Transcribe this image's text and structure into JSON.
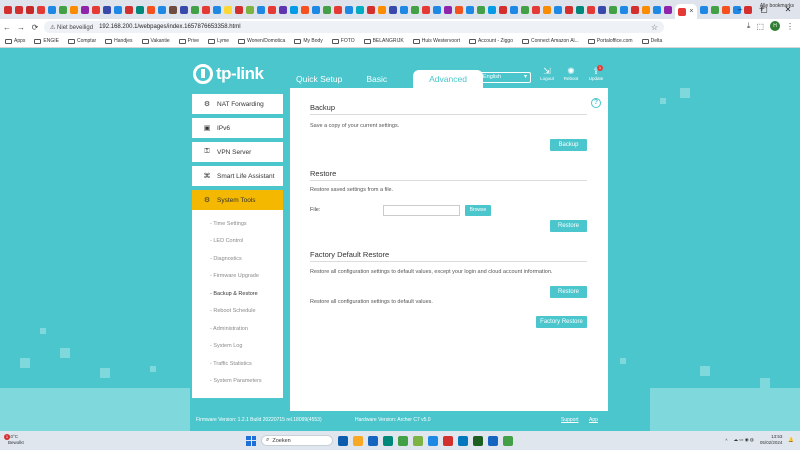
{
  "browser": {
    "tab_favicon_colors": [
      "#d32f2f",
      "#d32f2f",
      "#c62828",
      "#e53935",
      "#1e88e5",
      "#43a047",
      "#fb8c00",
      "#8e24aa",
      "#e53935",
      "#3949ab",
      "#1e88e5",
      "#d32f2f",
      "#00897b",
      "#f4511e",
      "#1e88e5",
      "#6d4c41",
      "#3949ab",
      "#43a047",
      "#e53935",
      "#1e88e5",
      "#fdd835",
      "#d32f2f",
      "#7cb342",
      "#1e88e5",
      "#e53935",
      "#5e35b1",
      "#039be5",
      "#f4511e",
      "#1e88e5",
      "#43a047",
      "#e53935",
      "#1e88e5",
      "#00acc1",
      "#d32f2f",
      "#fb8c00",
      "#3949ab",
      "#1e88e5",
      "#43a047",
      "#e53935",
      "#1e88e5",
      "#8e24aa",
      "#f4511e",
      "#1e88e5",
      "#43a047",
      "#039be5",
      "#d32f2f",
      "#1e88e5",
      "#43a047",
      "#e53935",
      "#fb8c00",
      "#1e88e5",
      "#d32f2f",
      "#00897b",
      "#e53935",
      "#3949ab",
      "#43a047",
      "#1e88e5",
      "#d32f2f",
      "#fb8c00",
      "#1e88e5",
      "#8e24aa",
      "#e53935",
      "#1e88e5",
      "#43a047",
      "#f4511e",
      "#1e88e5",
      "#d32f2f"
    ],
    "active_tab_close": "×",
    "new_tab": "+",
    "win_minimize": "–",
    "win_maximize": "▢",
    "win_close": "✕",
    "insecure_label": "⚠ Niet beveiligd",
    "url": "192.168.200.1/webpages/index.1657876653358.html",
    "profile_initial": "H",
    "bookmarks": [
      "Apps",
      "ENGIE",
      "Comptar",
      "Handjes",
      "Vakantie",
      "Prive",
      "Lyme",
      "Wonen/Domotica",
      "My Body",
      "FOTO",
      "BELANGRIJK",
      "Huis Westervoort",
      "Account - Ziggo",
      "Connect Amazon Al...",
      "Portaloffice.com",
      "Delta"
    ],
    "all_bookmarks": "Alle bookmarks"
  },
  "router": {
    "brand": "tp-link",
    "tabs": [
      "Quick Setup",
      "Basic",
      "Advanced"
    ],
    "language": "English",
    "tools": [
      {
        "label": "Logout",
        "icon": "⇲"
      },
      {
        "label": "Reboot",
        "icon": "✺"
      },
      {
        "label": "Update",
        "icon": "⇪",
        "badge": "1"
      }
    ],
    "sidebar": [
      {
        "label": "NAT Forwarding",
        "icon": "⚙"
      },
      {
        "label": "IPv6",
        "icon": "▣"
      },
      {
        "label": "VPN Server",
        "icon": "⚿"
      },
      {
        "label": "Smart Life Assistant",
        "icon": "⌘"
      },
      {
        "label": "System Tools",
        "icon": "⚙"
      }
    ],
    "subitems": [
      "- Time Settings",
      "- LED Control",
      "- Diagnostics",
      "- Firmware Upgrade",
      "- Backup & Restore",
      "- Reboot Schedule",
      "- Administration",
      "- System Log",
      "- Traffic Statistics",
      "- System Parameters"
    ],
    "help": "?",
    "backup": {
      "title": "Backup",
      "desc": "Save a copy of your current settings.",
      "button": "Backup"
    },
    "restore": {
      "title": "Restore",
      "desc": "Restore saved settings from a file.",
      "file_label": "File:",
      "browse": "Browse",
      "button": "Restore"
    },
    "factory": {
      "title": "Factory Default Restore",
      "desc1": "Restore all configuration settings to default values, except your login and cloud account information.",
      "button1": "Restore",
      "desc2": "Restore all configuration settings to default values.",
      "button2": "Factory Restore"
    },
    "footer": {
      "firmware": "Firmware Version: 1.2.1 Build 20220715 rel.18099(4553)",
      "hardware": "Hardware Version: Archer C7 v5.0",
      "support": "Support",
      "app": "App"
    }
  },
  "taskbar": {
    "weather_badge": "1",
    "weather_temp": "10°C",
    "weather_desc": "Bewolkt",
    "search": "Zoeken",
    "search_icon": "⌕",
    "app_colors": [
      "#0b5cad",
      "#f9a825",
      "#1565c0",
      "#00897b",
      "#43a047",
      "#7cb342",
      "#1e88e5",
      "#d32f2f",
      "#0277bd",
      "#1b5e20",
      "#1565c0",
      "#43a047"
    ],
    "time": "13:53",
    "date": "05/02/2024",
    "tray_up": "^",
    "tray_icons": "☁ ▭ ◉ ◍",
    "bell": "🔔"
  }
}
